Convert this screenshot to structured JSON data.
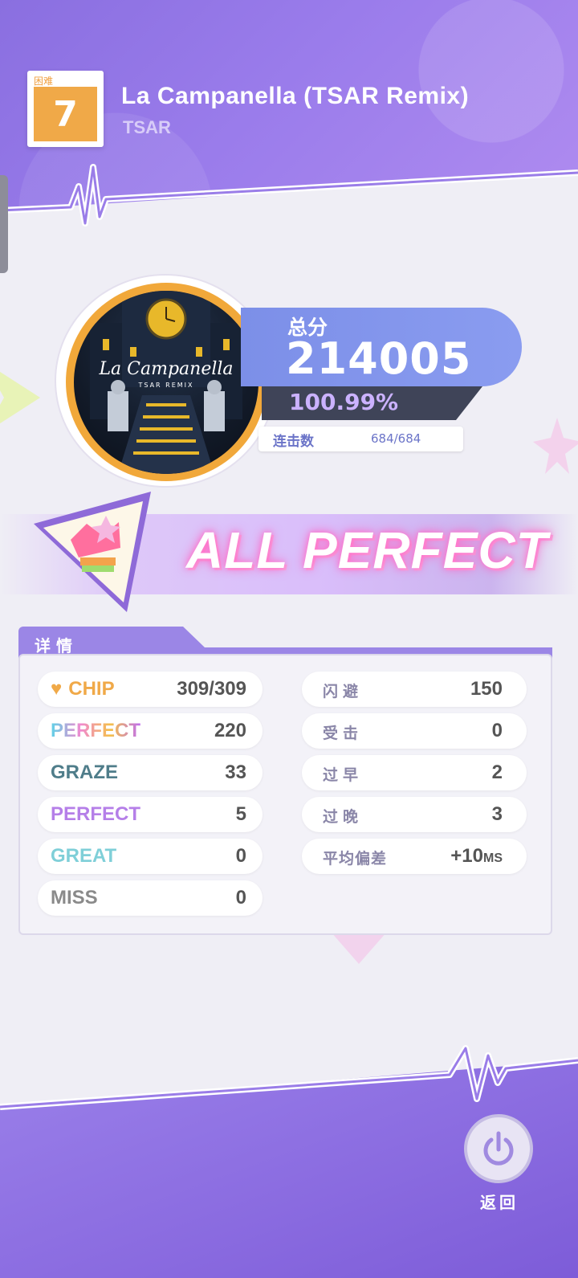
{
  "header": {
    "difficulty_label": "困难",
    "difficulty_level": "7",
    "song_title": "La Campanella (TSAR Remix)",
    "artist": "TSAR"
  },
  "cover": {
    "title_text": "La Campanella",
    "subtitle_text": "TSAR REMIX"
  },
  "score": {
    "label": "总分",
    "value": "214005",
    "accuracy": "100.99%",
    "combo_label": "连击数",
    "combo_value": "684/684"
  },
  "result": {
    "rank_text": "ALL PERFECT"
  },
  "details": {
    "title": "详 情",
    "left": [
      {
        "name": "CHIP",
        "value": "309/309",
        "color": "#f0a948",
        "icon": "heart-icon"
      },
      {
        "name": "PERFECT",
        "value": "220",
        "color": "#rainbow"
      },
      {
        "name": "GRAZE",
        "value": "33",
        "color": "#4f7d8a"
      },
      {
        "name": "PERFECT",
        "value": "5",
        "color": "#b57fe8"
      },
      {
        "name": "GREAT",
        "value": "0",
        "color": "#7fcfd8"
      },
      {
        "name": "MISS",
        "value": "0",
        "color": "#8a8a8a"
      }
    ],
    "right": [
      {
        "name": "闪避",
        "value": "150"
      },
      {
        "name": "受击",
        "value": "0"
      },
      {
        "name": "过早",
        "value": "2"
      },
      {
        "name": "过晚",
        "value": "3"
      },
      {
        "name": "平均偏差",
        "value": "+10",
        "unit": "MS"
      }
    ]
  },
  "footer": {
    "back_label": "返回"
  }
}
